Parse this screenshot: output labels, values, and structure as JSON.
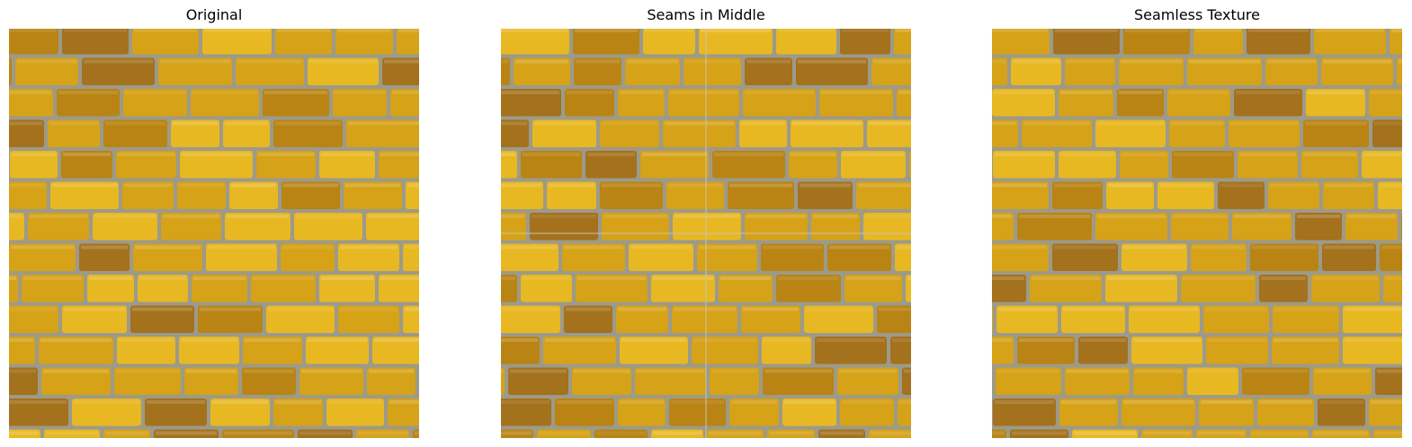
{
  "figure": {
    "panels": [
      {
        "title": "Original",
        "image": "yellow-brick-wall-texture",
        "variant": "original"
      },
      {
        "title": "Seams in Middle",
        "image": "yellow-brick-wall-texture-offset-seams",
        "variant": "seams"
      },
      {
        "title": "Seamless Texture",
        "image": "yellow-brick-wall-texture-seamless",
        "variant": "seamless"
      }
    ]
  },
  "colors": {
    "brick_base": "#d6a217",
    "brick_light": "#e8b822",
    "brick_dark": "#b98414",
    "brick_brown": "#a4711c",
    "mortar": "#9c9a8a",
    "mortar_light": "#b8b3a0",
    "seam_line": "#c9c4b0"
  }
}
